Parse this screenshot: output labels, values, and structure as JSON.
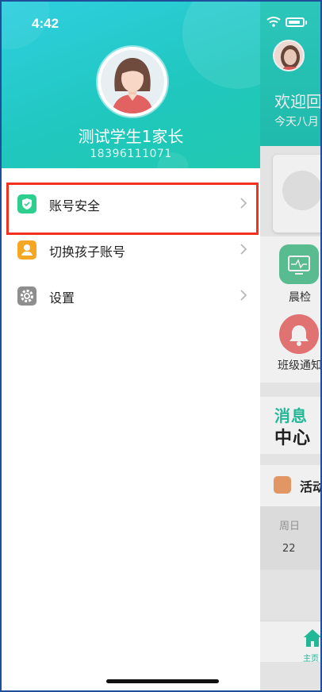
{
  "status_bar": {
    "time": "4:42"
  },
  "drawer": {
    "user_name": "测试学生1家长",
    "phone": "18396111071",
    "menu": [
      {
        "label": "账号安全",
        "icon": "shield-icon",
        "icon_color": "#2ccf8e"
      },
      {
        "label": "切换孩子账号",
        "icon": "user-icon",
        "icon_color": "#f5a623"
      },
      {
        "label": "设置",
        "icon": "gear-icon",
        "icon_color": "#8e8e8e"
      }
    ]
  },
  "background_app": {
    "welcome": "欢迎回",
    "date": "今天八月",
    "shortcuts": [
      "晨检",
      "班级通知"
    ],
    "message_center": {
      "line1": "消息",
      "line2": "中心"
    },
    "activity_title": "活动",
    "weekday": "周日",
    "day_number": "22",
    "tab_home": "主页"
  },
  "colors": {
    "accent": "#22c6b6",
    "highlight": "#f2321e"
  }
}
